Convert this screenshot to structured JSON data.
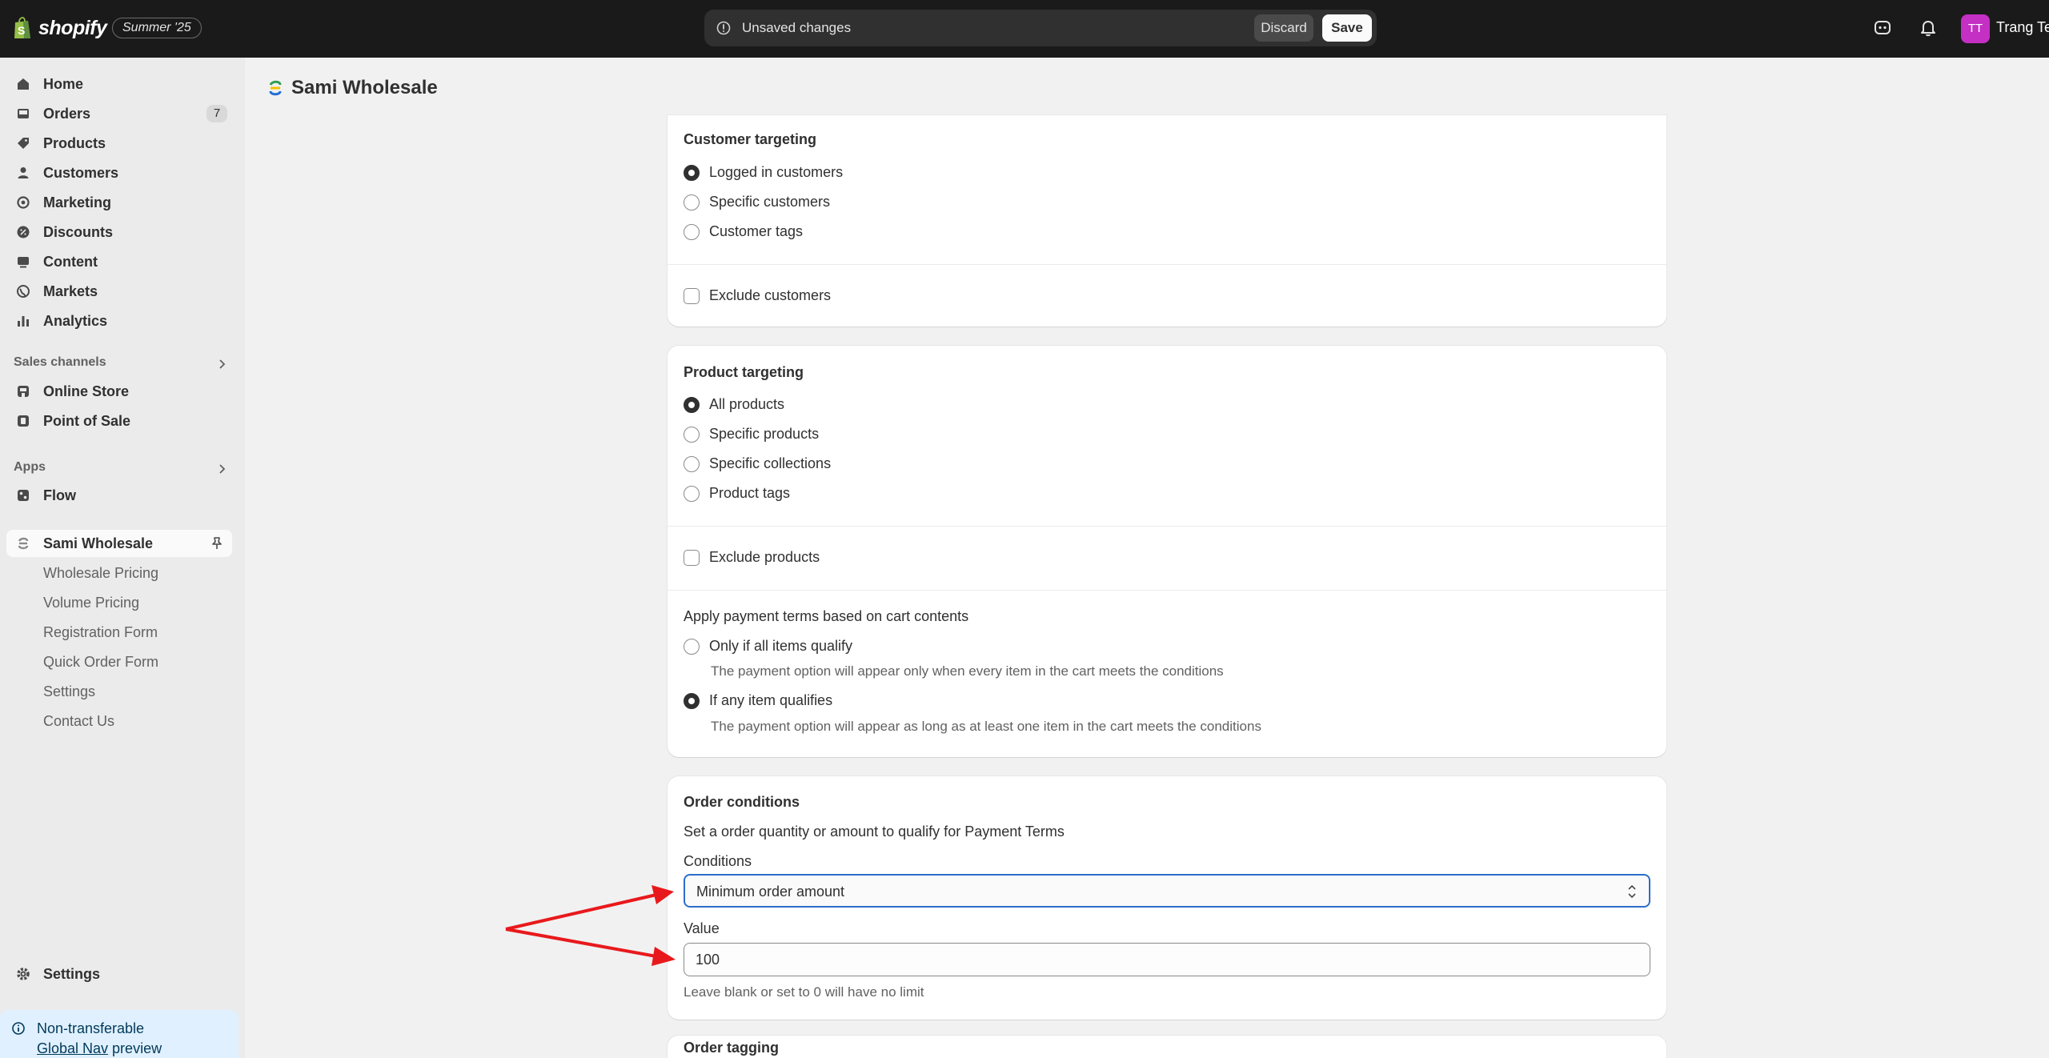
{
  "topbar": {
    "brand": "shopify",
    "edition": "Summer '25",
    "unsaved_message": "Unsaved changes",
    "discard_label": "Discard",
    "save_label": "Save",
    "avatar_initials": "TT",
    "user_name": "Trang Te"
  },
  "sidebar": {
    "main_items": [
      {
        "label": "Home",
        "icon": "home-icon"
      },
      {
        "label": "Orders",
        "icon": "inbox-icon",
        "badge": "7"
      },
      {
        "label": "Products",
        "icon": "tag-icon"
      },
      {
        "label": "Customers",
        "icon": "person-icon"
      },
      {
        "label": "Marketing",
        "icon": "target-icon"
      },
      {
        "label": "Discounts",
        "icon": "discount-icon"
      },
      {
        "label": "Content",
        "icon": "image-icon"
      },
      {
        "label": "Markets",
        "icon": "globe-icon"
      },
      {
        "label": "Analytics",
        "icon": "bar-chart-icon"
      }
    ],
    "sales_channels_label": "Sales channels",
    "sales_channels": [
      {
        "label": "Online Store",
        "icon": "store-icon"
      },
      {
        "label": "Point of Sale",
        "icon": "pos-icon"
      }
    ],
    "apps_label": "Apps",
    "apps": [
      {
        "label": "Flow",
        "icon": "flow-icon"
      }
    ],
    "active_app": "Sami Wholesale",
    "app_sub_items": [
      "Wholesale Pricing",
      "Volume Pricing",
      "Registration Form",
      "Quick Order Form",
      "Settings",
      "Contact Us"
    ],
    "settings_label": "Settings",
    "preview_line1": "Non-transferable",
    "preview_link": "Global Nav",
    "preview_tail": " preview"
  },
  "page": {
    "title": "Sami Wholesale"
  },
  "customer_targeting": {
    "title": "Customer targeting",
    "options": [
      "Logged in customers",
      "Specific customers",
      "Customer tags"
    ],
    "selected": 0,
    "exclude_label": "Exclude customers"
  },
  "product_targeting": {
    "title": "Product targeting",
    "options": [
      "All products",
      "Specific products",
      "Specific collections",
      "Product tags"
    ],
    "selected": 0,
    "exclude_label": "Exclude products",
    "cart_heading": "Apply payment terms based on cart contents",
    "cart_options": [
      {
        "label": "Only if all items qualify",
        "help": "The payment option will appear only when every item in the cart meets the conditions"
      },
      {
        "label": "If any item qualifies",
        "help": "The payment option will appear as long as at least one item in the cart meets the conditions"
      }
    ],
    "cart_selected": 1
  },
  "order_conditions": {
    "title": "Order conditions",
    "description": "Set a order quantity or amount to qualify for Payment Terms",
    "conditions_label": "Conditions",
    "conditions_value": "Minimum order amount",
    "value_label": "Value",
    "value": "100",
    "hint": "Leave blank or set to 0 will have no limit"
  },
  "order_tagging": {
    "title": "Order tagging"
  },
  "colors": {
    "topbar": "#1a1a1a",
    "focus": "#2c6ecb",
    "annotation": "#e8191c",
    "avatar": "#c42fc4"
  }
}
